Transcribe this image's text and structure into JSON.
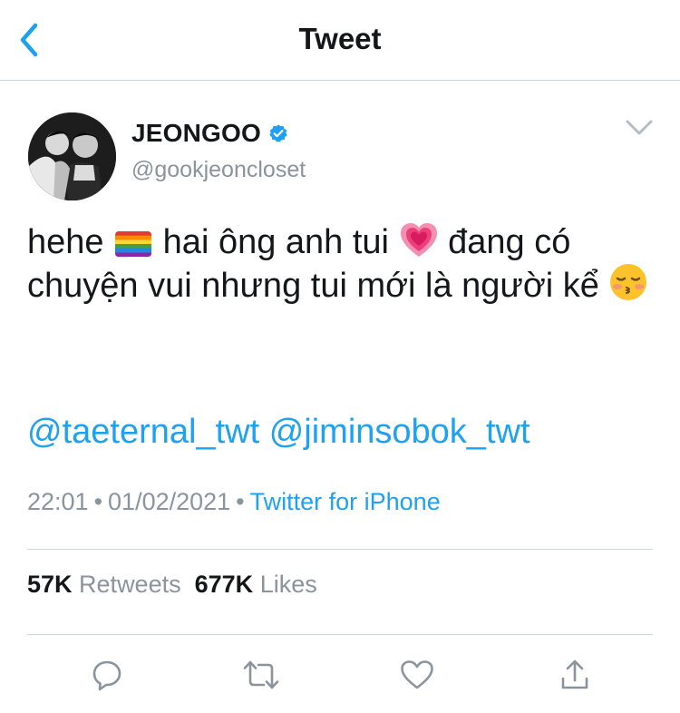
{
  "nav": {
    "title": "Tweet",
    "back_icon": "chevron-left-icon"
  },
  "tweet": {
    "display_name": "JEONGOO",
    "handle": "@gookjeoncloset",
    "verified": true,
    "text_part1": "hehe",
    "emoji_1": "rainbow-flag",
    "text_part2": "hai ông anh tui",
    "emoji_2": "growing-heart",
    "text_part3": "đang có chuyện vui nhưng tui mới là người kể",
    "emoji_3": "kissing-face-closed-eyes",
    "mention_1": "@taeternal_twt",
    "mention_2": "@jiminsobok_twt",
    "time": "22:01",
    "date": "01/02/2021",
    "source": "Twitter for iPhone"
  },
  "stats": {
    "retweets_count": "57K",
    "retweets_label": "Retweets",
    "likes_count": "677K",
    "likes_label": "Likes"
  },
  "colors": {
    "accent": "#1da1f2",
    "muted": "#8a949c",
    "text": "#14171a"
  }
}
